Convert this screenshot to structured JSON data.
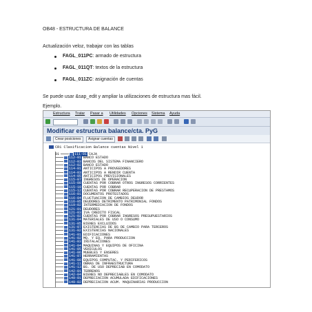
{
  "doc": {
    "heading": "OB48 - ESTRUCTURA DE BALANCE",
    "intro": "Actualización veloz, trabajar con las tablas",
    "bullets": [
      {
        "key": "FAGL_011PC",
        "text": ":  armado de estructura"
      },
      {
        "key": "FAGL_011QT",
        "text": ": textos de la estructura"
      },
      {
        "key": "FAGL_011ZC",
        "text": ": asignación de cuentas"
      }
    ],
    "note": "Se puede usar &sap_edit y ampliar la utilizaciones de estructura mas fácil.",
    "example_label": "Ejemplo."
  },
  "sap": {
    "menu": [
      "Estructura",
      "Tratar",
      "Pasar a",
      "Utilidades",
      "Opciones",
      "Sistema",
      "Ayuda"
    ],
    "window_title": "Modificar estructura balance/cta. PyG",
    "buttons": [
      "Crear posiciones",
      "Asignar cuentas"
    ],
    "root_label": "CR1 Clasificacion Balance cuentas Nivel 1",
    "root_code": "01",
    "rows": [
      {
        "code": "111-01",
        "label": "CAJA"
      },
      {
        "code": "112-01",
        "label": "BANCO ESTADO"
      },
      {
        "code": "112-03",
        "label": "BANCOS DEL SISTEMA FINANCIERO"
      },
      {
        "code": "112-02",
        "label": "BANCO ESTADO"
      },
      {
        "code": "114-01",
        "label": "ANTICIPOS A PROVEEDORES"
      },
      {
        "code": "114-03",
        "label": "ANTICIPOS A RENDIR CUENTA"
      },
      {
        "code": "114-05",
        "label": "ANTICIPOS PREVISIONALES"
      },
      {
        "code": "115-07",
        "label": "INGRESOS DE OPERACION"
      },
      {
        "code": "115-08",
        "label": "CUENTAS POR COBRAR OTROS INGRESOS CORRIENTES"
      },
      {
        "code": "115-10",
        "label": "CUENTAS POR COBRAR"
      },
      {
        "code": "115-12",
        "label": "CUENTAS POR COBRAR RECUPERACION DE PRESTAMOS"
      },
      {
        "code": "116-01",
        "label": "DOCUMENTOS PROTESTADOS"
      },
      {
        "code": "116-04",
        "label": "FLUCTUACION DE CAMBIOS DEUDOR"
      },
      {
        "code": "116-05",
        "label": "DEUDORES DETRIMENTO PATRIMONIAL FONDOS"
      },
      {
        "code": "119-02",
        "label": "INTERMEDIACION DE FONDOS"
      },
      {
        "code": "121-01",
        "label": "DEUDORES"
      },
      {
        "code": "121-03",
        "label": "IVA CREDITO FISCAL"
      },
      {
        "code": "121-02",
        "label": "CUENTAS POR COBRAR INGRESOS PRESUPUESTARIOS"
      },
      {
        "code": "131-04",
        "label": "MATERIALES DE USO O CONSUMO"
      },
      {
        "code": "131-05",
        "label": "BIENES EXCLUIDOS"
      },
      {
        "code": "131-07",
        "label": "EXISTENCIAS DE BS DE CAMBIO PARA TERCEROS"
      },
      {
        "code": "131-02",
        "label": "EXISTENCIAS NACIONALES"
      },
      {
        "code": "141-01",
        "label": "EDIFICACIONES"
      },
      {
        "code": "141-02",
        "label": "MQ. Y EQ. PARA PRODUCCION"
      },
      {
        "code": "141-03",
        "label": "INSTALACIONES"
      },
      {
        "code": "141-04",
        "label": "MAQUINAS Y EQUIPOS DE OFICINA"
      },
      {
        "code": "141-05",
        "label": "VEHICULOS"
      },
      {
        "code": "141-06",
        "label": "MUEBLES Y ENSERES"
      },
      {
        "code": "141-07",
        "label": "HERRAMIENTAS"
      },
      {
        "code": "141-08",
        "label": "EQUIPOS COMPUTAC. Y PERIFERICOS"
      },
      {
        "code": "141-11",
        "label": "OBRAS DE INFRAESTRUCTURA"
      },
      {
        "code": "141-13",
        "label": "BS. DE USO DEPRECIAB EN COMODATO"
      },
      {
        "code": "142-01",
        "label": "TERRENOS"
      },
      {
        "code": "142-04",
        "label": "BIENES NO DEPRECIABLES EN COMODATO"
      },
      {
        "code": "149-01",
        "label": "DEPRECIACION ACUMULADA EDIFICACIONES"
      },
      {
        "code": "149-02",
        "label": "DEPRECIACION ACUM. MAQUINARIAS PRODUCCION"
      }
    ]
  }
}
